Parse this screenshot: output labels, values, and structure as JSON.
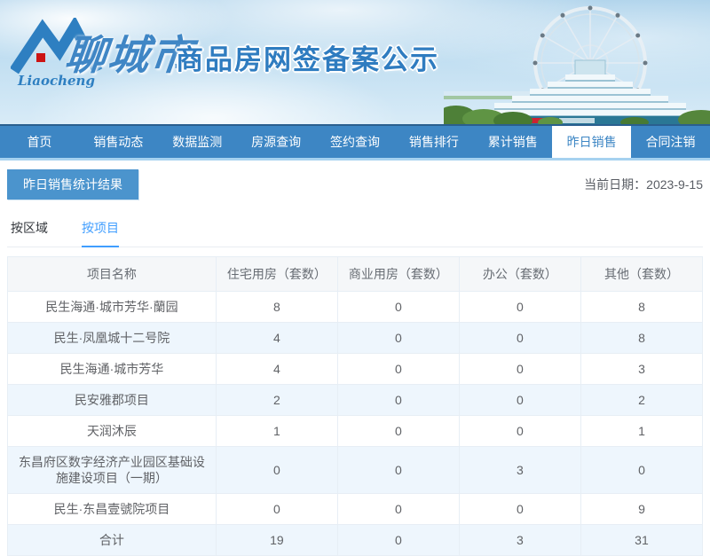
{
  "header": {
    "logo_script": "Liaocheng",
    "city_name": "聊城市",
    "banner_title": "商品房网签备案公示"
  },
  "nav": {
    "items": [
      {
        "label": "首页",
        "active": false
      },
      {
        "label": "销售动态",
        "active": false
      },
      {
        "label": "数据监测",
        "active": false
      },
      {
        "label": "房源查询",
        "active": false
      },
      {
        "label": "签约查询",
        "active": false
      },
      {
        "label": "销售排行",
        "active": false
      },
      {
        "label": "累计销售",
        "active": false
      },
      {
        "label": "昨日销售",
        "active": true
      },
      {
        "label": "合同注销",
        "active": false
      }
    ]
  },
  "section": {
    "title": "昨日销售统计结果",
    "date_label": "当前日期：",
    "date_value": "2023-9-15"
  },
  "tabs": [
    {
      "label": "按区域",
      "active": false
    },
    {
      "label": "按项目",
      "active": true
    }
  ],
  "table": {
    "columns": [
      "项目名称",
      "住宅用房（套数）",
      "商业用房（套数）",
      "办公（套数）",
      "其他（套数）"
    ],
    "rows": [
      [
        "民生海通·城市芳华·蘭园",
        "8",
        "0",
        "0",
        "8"
      ],
      [
        "民生·凤凰城十二号院",
        "4",
        "0",
        "0",
        "8"
      ],
      [
        "民生海通·城市芳华",
        "4",
        "0",
        "0",
        "3"
      ],
      [
        "民安雅郡项目",
        "2",
        "0",
        "0",
        "2"
      ],
      [
        "天润沐辰",
        "1",
        "0",
        "0",
        "1"
      ],
      [
        "东昌府区数字经济产业园区基础设施建设项目（一期）",
        "0",
        "0",
        "3",
        "0"
      ],
      [
        "民生·东昌壹號院项目",
        "0",
        "0",
        "0",
        "9"
      ],
      [
        "合计",
        "19",
        "0",
        "3",
        "31"
      ]
    ]
  },
  "colors": {
    "nav_blue": "#3d86c4",
    "badge_blue": "#4b94cd",
    "active_tab_blue": "#409eff",
    "banner_text_blue": "#2f7cc0",
    "row_stripe": "#eef6fd",
    "table_border": "#e7eef5"
  }
}
